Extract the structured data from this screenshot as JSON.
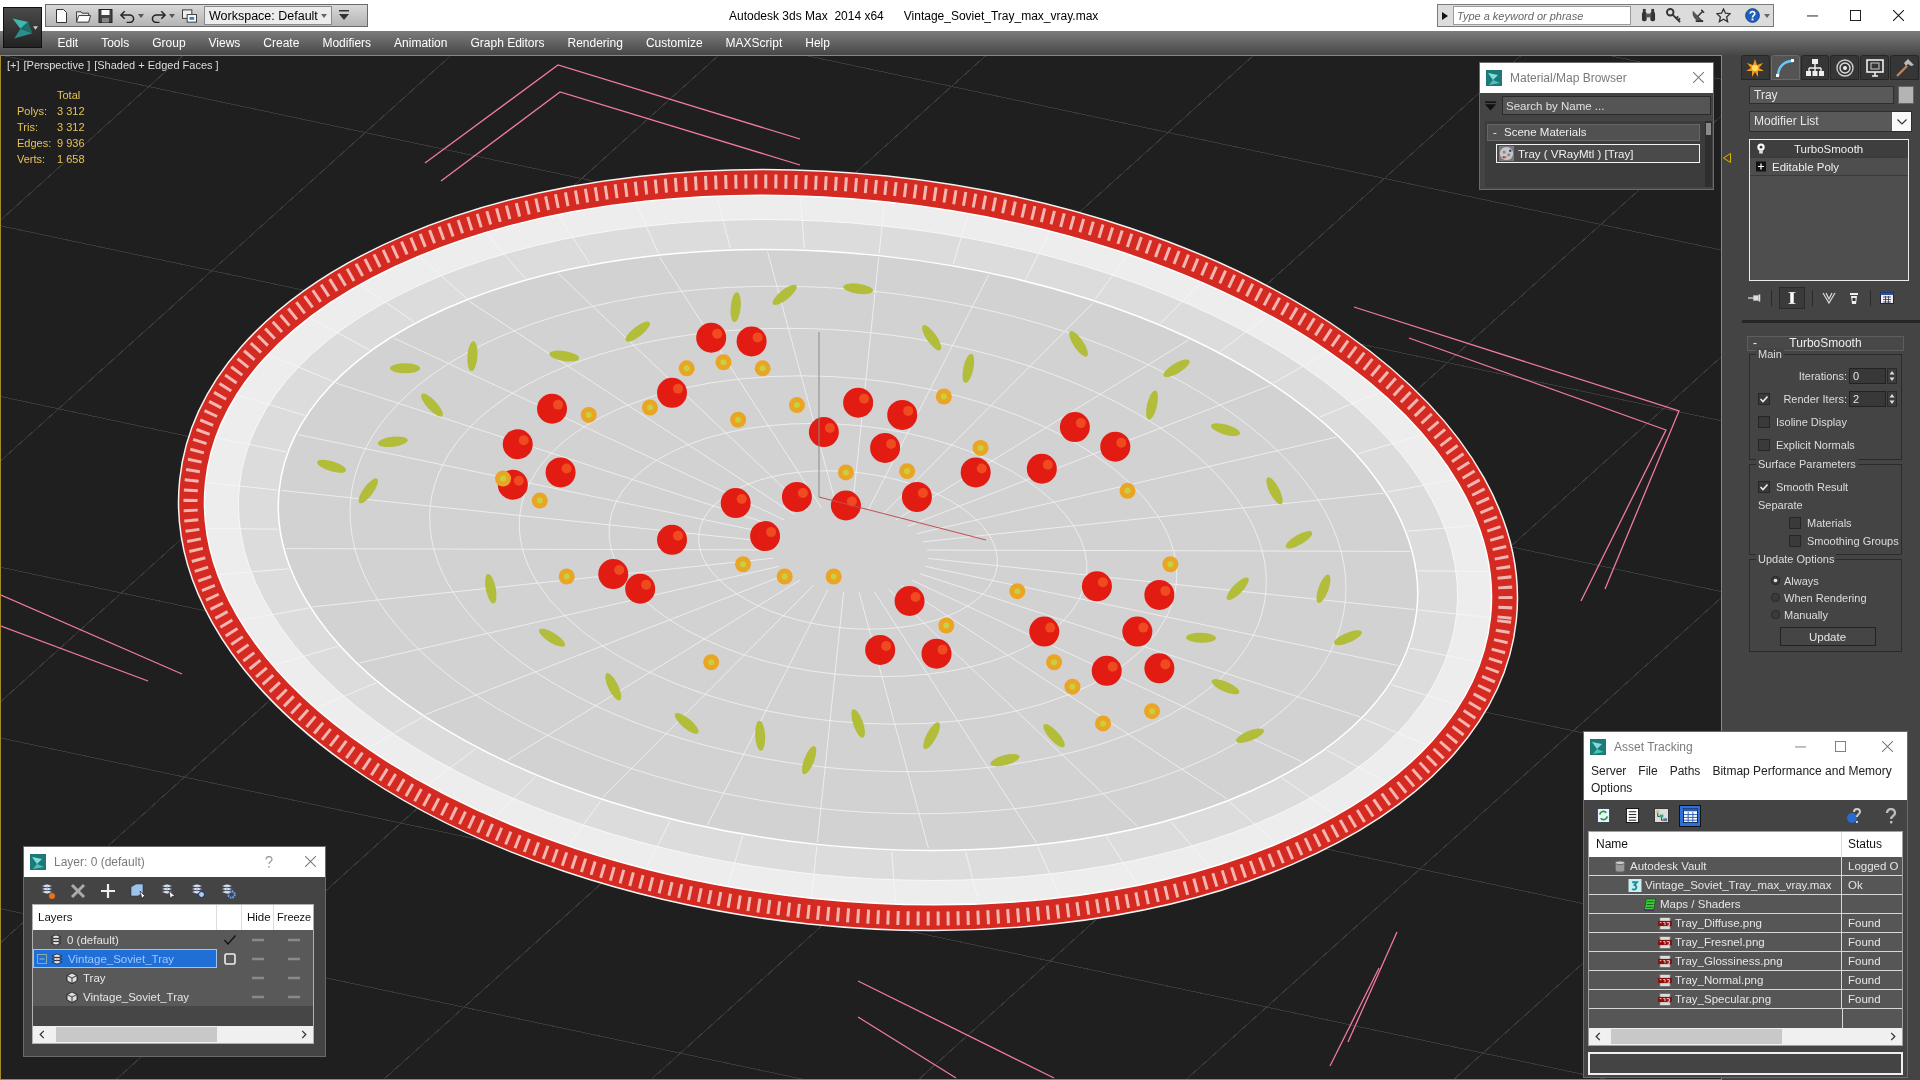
{
  "title_bar": {
    "workspace": "Workspace: Default",
    "app_title": "Autodesk 3ds Max  2014 x64",
    "file_name": "Vintage_Soviet_Tray_max_vray.max",
    "search": {
      "placeholder": "Type a keyword or phrase"
    }
  },
  "menu_bar": [
    "Edit",
    "Tools",
    "Group",
    "Views",
    "Create",
    "Modifiers",
    "Animation",
    "Graph Editors",
    "Rendering",
    "Customize",
    "MAXScript",
    "Help"
  ],
  "viewport": {
    "labels": [
      "[+]",
      "[Perspective ]",
      "[Shaded + Edged Faces ]"
    ],
    "stats": {
      "heading": "Total",
      "rows": [
        {
          "label": "Polys:",
          "value": "3 312"
        },
        {
          "label": "Tris:",
          "value": "3 312"
        },
        {
          "label": "Edges:",
          "value": "9 936"
        },
        {
          "label": "Verts:",
          "value": "1 658"
        }
      ]
    }
  },
  "material_browser": {
    "title": "Material/Map Browser",
    "search": {
      "placeholder": "Search by Name ..."
    },
    "group": {
      "toggle": "-",
      "label": "Scene Materials"
    },
    "items": [
      {
        "label": "Tray ( VRayMtl ) [Tray]",
        "selected": true
      }
    ]
  },
  "command_panel": {
    "tabs": [
      {
        "selected": false
      },
      {
        "selected": true
      },
      {
        "selected": false
      },
      {
        "selected": false
      },
      {
        "selected": false
      },
      {
        "selected": false
      }
    ],
    "object_name": "Tray",
    "modifier_list": "Modifier List",
    "stack": [
      {
        "label": "TurboSmooth",
        "kind": "modifier",
        "selected": true
      },
      {
        "label": "Editable Poly",
        "kind": "object",
        "selected": false
      }
    ],
    "stack_tools": [
      {
        "selected": false
      },
      {
        "selected": true
      },
      {
        "selected": false
      },
      {
        "selected": false
      },
      {
        "selected": false
      }
    ],
    "rollout": {
      "toggle": "-",
      "title": "TurboSmooth",
      "groups": [
        {
          "title": "Main",
          "controls": [
            {
              "kind": "spinner",
              "label": "Iterations:",
              "value": "0"
            },
            {
              "kind": "check-spinner",
              "label": "Render Iters:",
              "value": "2",
              "checked": true
            },
            {
              "kind": "checkbox",
              "label": "Isoline Display",
              "checked": false
            },
            {
              "kind": "checkbox",
              "label": "Explicit Normals",
              "checked": false
            }
          ]
        },
        {
          "title": "Surface Parameters",
          "controls": [
            {
              "kind": "checkbox",
              "label": "Smooth Result",
              "checked": true
            },
            {
              "kind": "label",
              "label": "Separate",
              "children": [
                {
                  "kind": "checkbox",
                  "label": "Materials",
                  "checked": false
                },
                {
                  "kind": "checkbox",
                  "label": "Smoothing Groups",
                  "checked": false
                }
              ]
            }
          ]
        },
        {
          "title": "Update Options",
          "controls": [
            {
              "kind": "radio",
              "label": "Always",
              "selected": true
            },
            {
              "kind": "radio",
              "label": "When Rendering",
              "selected": false
            },
            {
              "kind": "radio",
              "label": "Manually",
              "selected": false
            },
            {
              "kind": "button",
              "label": "Update"
            }
          ]
        }
      ]
    }
  },
  "layer_window": {
    "title": "Layer: 0 (default)",
    "columns": [
      "Layers",
      "Hide",
      "Freeze"
    ],
    "rows": [
      {
        "name": "0 (default)",
        "kind": "layer",
        "current": true,
        "selected": false,
        "hidden": false,
        "frozen": false
      },
      {
        "name": "Vintage_Soviet_Tray",
        "kind": "layer",
        "current": false,
        "selected": true,
        "expanded": true,
        "hidden": false,
        "frozen": false,
        "children": [
          {
            "name": "Tray",
            "kind": "object",
            "selected": false,
            "hidden": false,
            "frozen": false
          },
          {
            "name": "Vintage_Soviet_Tray",
            "kind": "object",
            "selected": false,
            "hidden": false,
            "frozen": false
          }
        ]
      }
    ]
  },
  "asset_tracking": {
    "title": "Asset Tracking",
    "menu": [
      "Server",
      "File",
      "Paths",
      "Bitmap Performance and Memory",
      "Options"
    ],
    "tools": [
      {
        "selected": false
      },
      {
        "selected": false
      },
      {
        "selected": false
      },
      {
        "selected": true
      }
    ],
    "columns": [
      "Name",
      "Status"
    ],
    "rows": [
      {
        "name": "Autodesk Vault",
        "kind": "vault",
        "status": "Logged O",
        "selected": false,
        "children": [
          {
            "name": "Vintage_Soviet_Tray_max_vray.max",
            "kind": "scene",
            "status": "Ok",
            "selected": false,
            "children": [
              {
                "name": "Maps / Shaders",
                "kind": "folder",
                "selected": false,
                "children": [
                  {
                    "name": "Tray_Diffuse.png",
                    "kind": "image",
                    "status": "Found",
                    "selected": false
                  },
                  {
                    "name": "Tray_Fresnel.png",
                    "kind": "image",
                    "status": "Found",
                    "selected": false
                  },
                  {
                    "name": "Tray_Glossiness.png",
                    "kind": "image",
                    "status": "Found",
                    "selected": false
                  },
                  {
                    "name": "Tray_Normal.png",
                    "kind": "image",
                    "status": "Found",
                    "selected": false
                  },
                  {
                    "name": "Tray_Specular.png",
                    "kind": "image",
                    "status": "Found",
                    "selected": false
                  }
                ]
              }
            ]
          }
        ]
      }
    ]
  }
}
